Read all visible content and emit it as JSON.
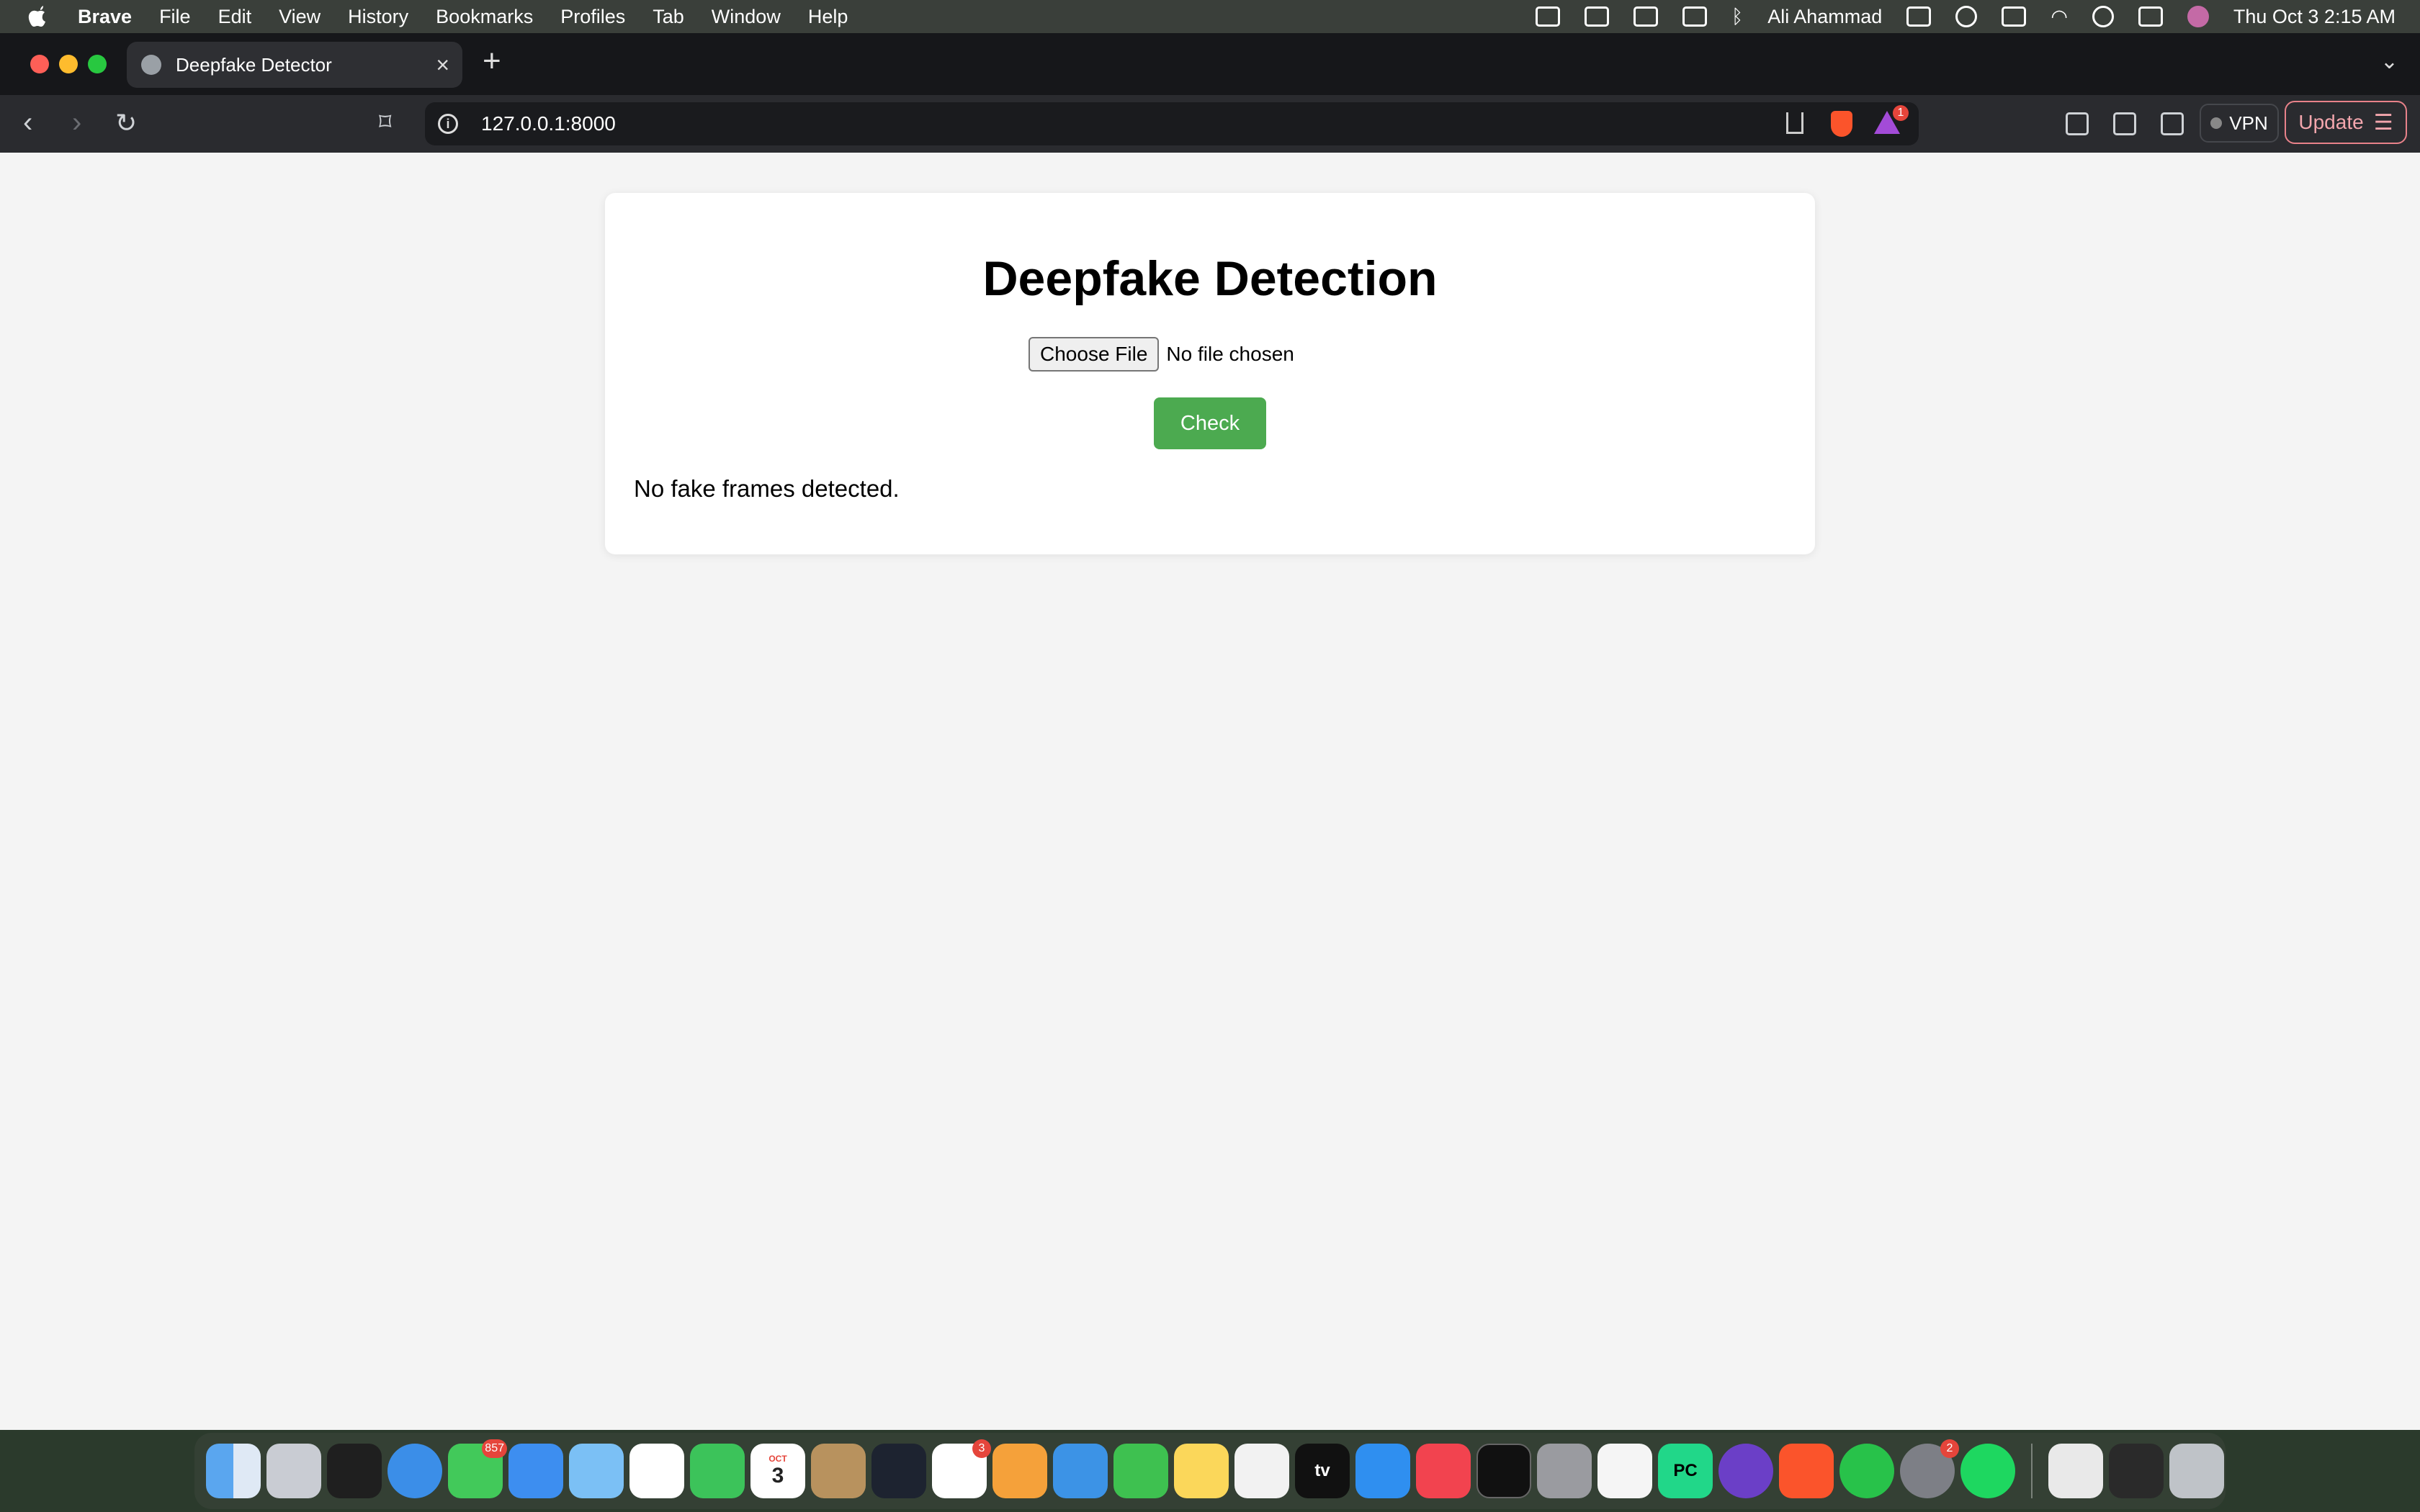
{
  "menubar": {
    "app_name": "Brave",
    "items": [
      "File",
      "Edit",
      "View",
      "History",
      "Bookmarks",
      "Profiles",
      "Tab",
      "Window",
      "Help"
    ],
    "user_name": "Ali  Ahammad",
    "datetime": "Thu Oct 3  2:15 AM"
  },
  "browser": {
    "tab_title": "Deepfake Detector",
    "url": "127.0.0.1:8000",
    "rewards_badge": "1",
    "vpn_label": "VPN",
    "update_label": "Update"
  },
  "page": {
    "title": "Deepfake Detection",
    "choose_file_label": "Choose File",
    "no_file_text": "No file chosen",
    "check_label": "Check",
    "result_text": "No fake frames detected.",
    "check_color": "#4caa50"
  },
  "dock": {
    "messages_badge": "857",
    "calendar_month": "OCT",
    "calendar_day": "3",
    "reminders_badge": "3",
    "settings_badge": "2",
    "tv_label": "tv",
    "pycharm_label": "PC"
  }
}
